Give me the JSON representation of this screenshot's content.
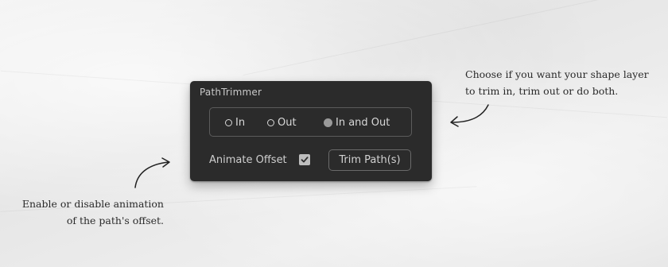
{
  "panel": {
    "title": "PathTrimmer",
    "modes": [
      {
        "label": "In",
        "selected": false
      },
      {
        "label": "Out",
        "selected": false
      },
      {
        "label": "In and Out",
        "selected": true
      }
    ],
    "animate_offset_label": "Animate Offset",
    "animate_offset_checked": true,
    "trim_button_label": "Trim Path(s)"
  },
  "annotations": {
    "right_line1": "Choose if you want your shape layer",
    "right_line2": "to trim in, trim out or do both.",
    "left_line1": "Enable or disable animation",
    "left_line2": "of the path's offset."
  },
  "colors": {
    "panel_bg": "#2b2b2b",
    "panel_text": "#d8d8d8",
    "selected_radio": "#9a9a9a",
    "paper_bg": "#ededed"
  },
  "icons": {
    "checkbox": "checkmark-icon",
    "arrows": "hand-drawn-arrow-icon"
  }
}
